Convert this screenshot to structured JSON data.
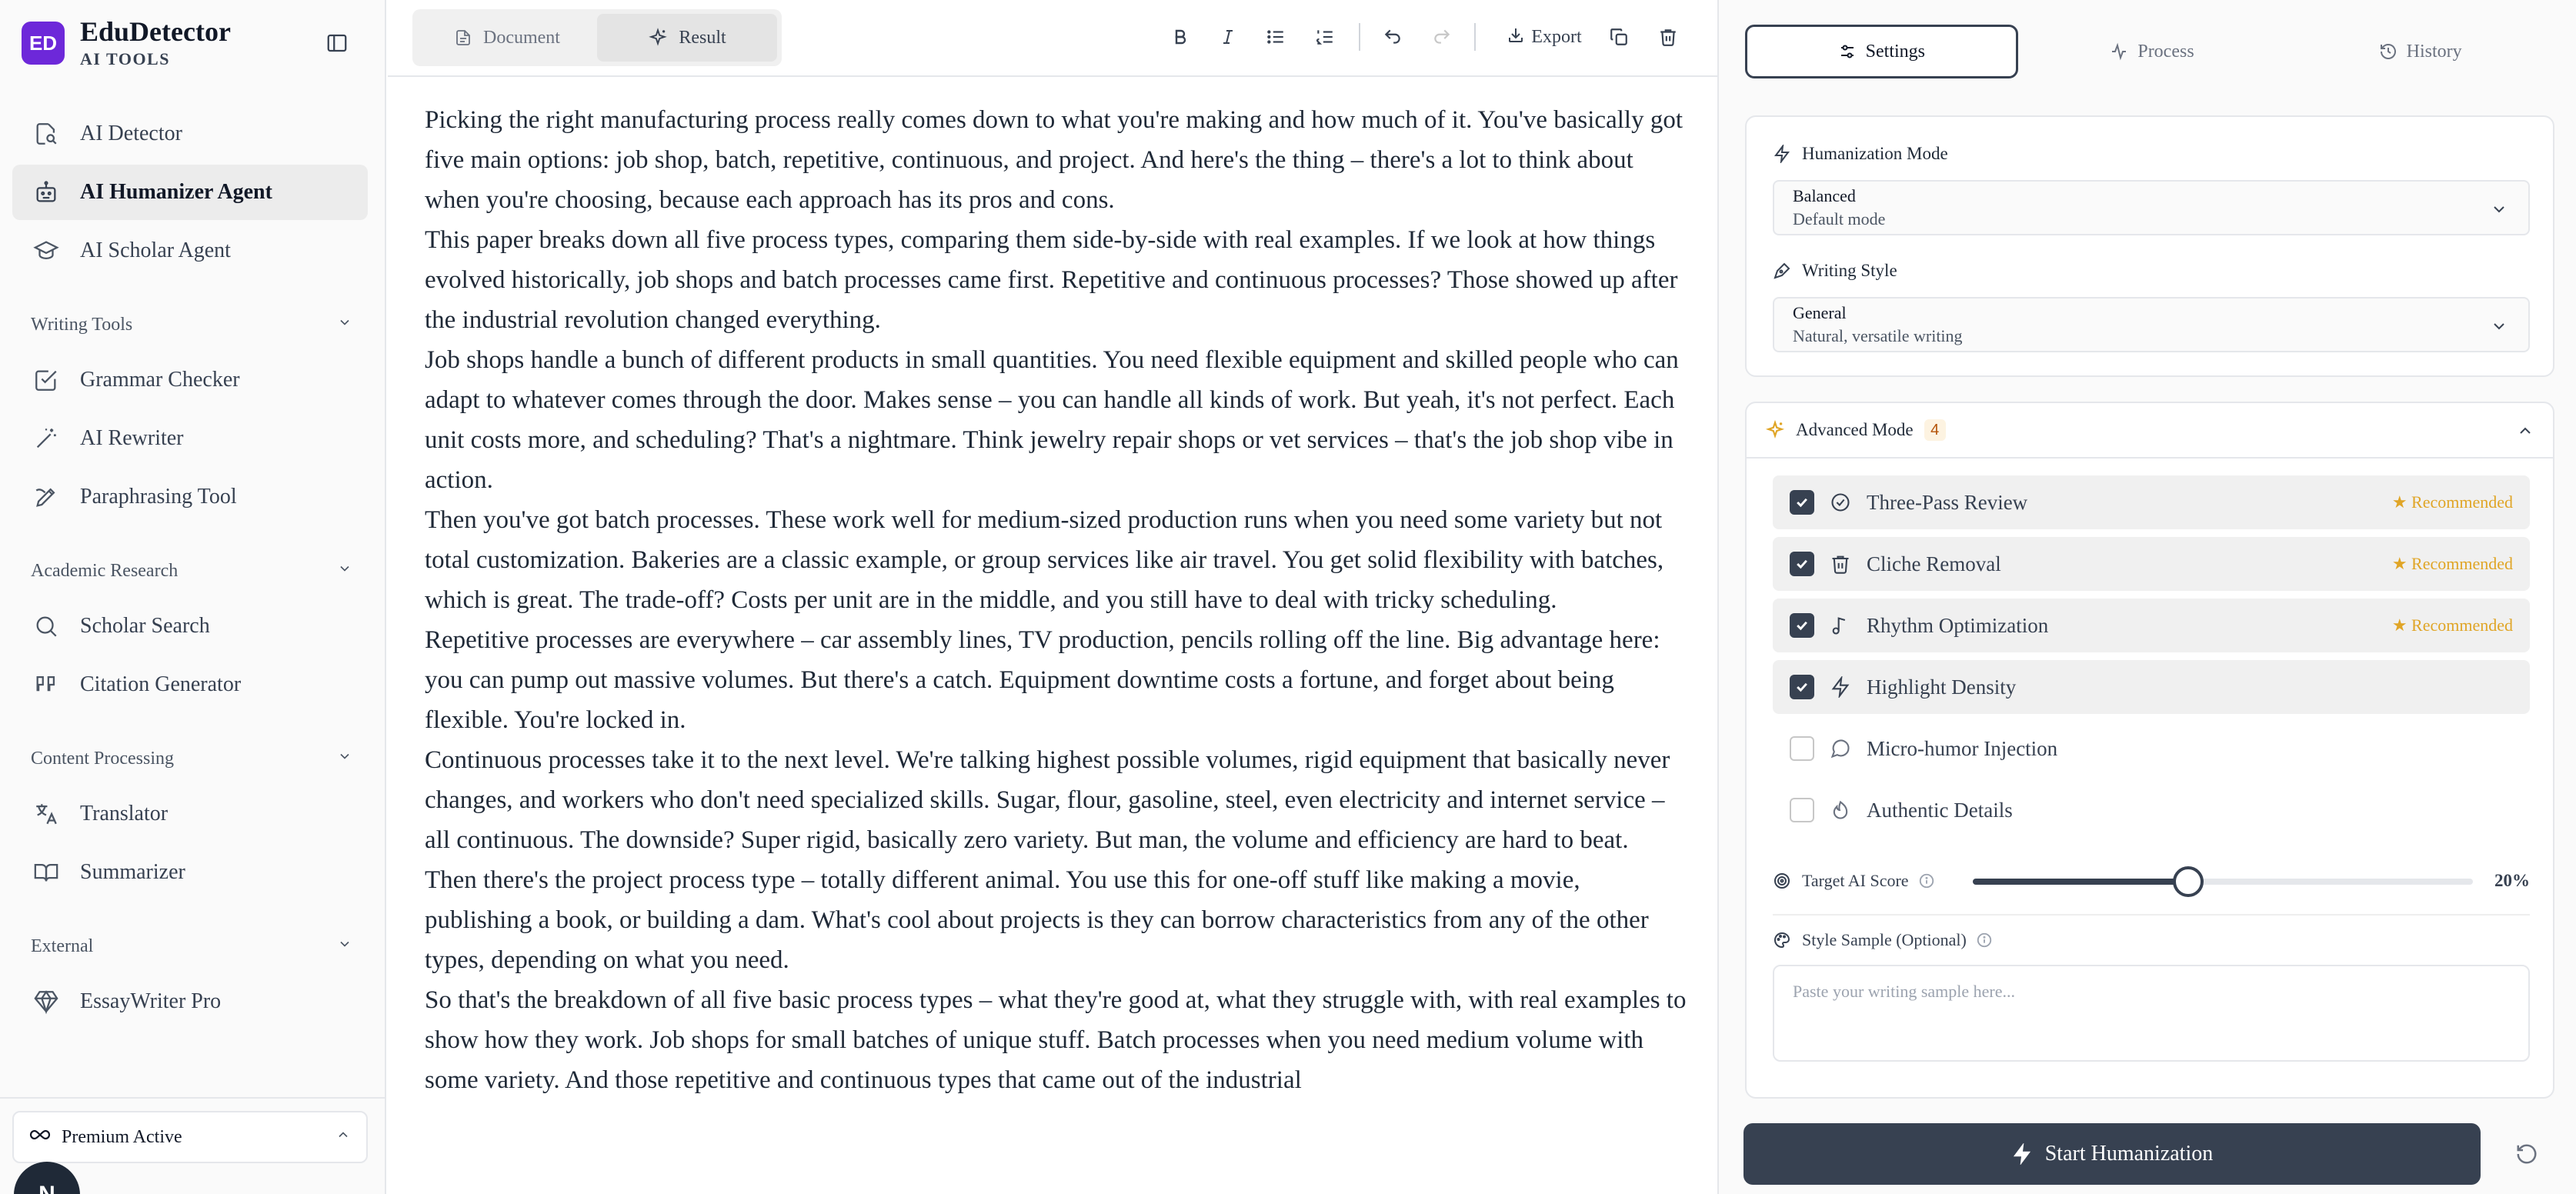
{
  "brand": {
    "logo": "ED",
    "name": "EduDetector",
    "subtitle": "AI TOOLS"
  },
  "sidebar": {
    "top_items": [
      {
        "label": "AI Detector",
        "icon": "document-search-icon"
      },
      {
        "label": "AI Humanizer Agent",
        "icon": "robot-icon",
        "active": true
      },
      {
        "label": "AI Scholar Agent",
        "icon": "graduation-cap-icon"
      }
    ],
    "sections": [
      {
        "title": "Writing Tools",
        "items": [
          {
            "label": "Grammar Checker",
            "icon": "check-square-icon"
          },
          {
            "label": "AI Rewriter",
            "icon": "magic-wand-icon"
          },
          {
            "label": "Paraphrasing Tool",
            "icon": "pen-icon"
          }
        ]
      },
      {
        "title": "Academic Research",
        "items": [
          {
            "label": "Scholar Search",
            "icon": "search-icon"
          },
          {
            "label": "Citation Generator",
            "icon": "quote-icon"
          }
        ]
      },
      {
        "title": "Content Processing",
        "items": [
          {
            "label": "Translator",
            "icon": "translate-icon"
          },
          {
            "label": "Summarizer",
            "icon": "book-icon"
          }
        ]
      },
      {
        "title": "External",
        "items": [
          {
            "label": "EssayWriter Pro",
            "icon": "gem-icon"
          }
        ]
      }
    ],
    "premium": "Premium Active",
    "avatar_initial": "N"
  },
  "editor": {
    "tabs": [
      {
        "label": "Document",
        "active": false
      },
      {
        "label": "Result",
        "active": true
      }
    ],
    "export_label": "Export",
    "paragraphs": [
      "Picking the right manufacturing process really comes down to what you're making and how much of it. You've basically got five main options: job shop, batch, repetitive, continuous, and project. And here's the thing – there's a lot to think about when you're choosing, because each approach has its pros and cons.",
      "This paper breaks down all five process types, comparing them side-by-side with real examples. If we look at how things evolved historically, job shops and batch processes came first. Repetitive and continuous processes? Those showed up after the industrial revolution changed everything.",
      "Job shops handle a bunch of different products in small quantities. You need flexible equipment and skilled people who can adapt to whatever comes through the door. Makes sense – you can handle all kinds of work. But yeah, it's not perfect. Each unit costs more, and scheduling? That's a nightmare. Think jewelry repair shops or vet services – that's the job shop vibe in action.",
      "Then you've got batch processes. These work well for medium-sized production runs when you need some variety but not total customization. Bakeries are a classic example, or group services like air travel. You get solid flexibility with batches, which is great. The trade-off? Costs per unit are in the middle, and you still have to deal with tricky scheduling.",
      "Repetitive processes are everywhere – car assembly lines, TV production, pencils rolling off the line. Big advantage here: you can pump out massive volumes. But there's a catch. Equipment downtime costs a fortune, and forget about being flexible. You're locked in.",
      "Continuous processes take it to the next level. We're talking highest possible volumes, rigid equipment that basically never changes, and workers who don't need specialized skills. Sugar, flour, gasoline, steel, even electricity and internet service – all continuous. The downside? Super rigid, basically zero variety. But man, the volume and efficiency are hard to beat.",
      "Then there's the project process type – totally different animal. You use this for one-off stuff like making a movie, publishing a book, or building a dam. What's cool about projects is they can borrow characteristics from any of the other types, depending on what you need.",
      "So that's the breakdown of all five basic process types – what they're good at, what they struggle with, with real examples to show how they work. Job shops for small batches of unique stuff. Batch processes when you need medium volume with some variety. And those repetitive and continuous types that came out of the industrial"
    ]
  },
  "panel": {
    "tabs": [
      {
        "label": "Settings",
        "active": true
      },
      {
        "label": "Process",
        "active": false
      },
      {
        "label": "History",
        "active": false
      }
    ],
    "humanization_mode": {
      "label": "Humanization Mode",
      "value": "Balanced",
      "description": "Default mode"
    },
    "writing_style": {
      "label": "Writing Style",
      "value": "General",
      "description": "Natural, versatile writing"
    },
    "advanced": {
      "label": "Advanced Mode",
      "count": "4",
      "options": [
        {
          "label": "Three-Pass Review",
          "checked": true,
          "recommended": "★ Recommended",
          "icon": "check-circle-icon"
        },
        {
          "label": "Cliche Removal",
          "checked": true,
          "recommended": "★ Recommended",
          "icon": "trash-icon"
        },
        {
          "label": "Rhythm Optimization",
          "checked": true,
          "recommended": "★ Recommended",
          "icon": "music-note-icon"
        },
        {
          "label": "Highlight Density",
          "checked": true,
          "recommended": "",
          "icon": "lightning-icon"
        },
        {
          "label": "Micro-humor Injection",
          "checked": false,
          "recommended": "",
          "icon": "chat-bubble-icon"
        },
        {
          "label": "Authentic Details",
          "checked": false,
          "recommended": "",
          "icon": "fingerprint-icon"
        }
      ]
    },
    "target_score": {
      "label": "Target AI Score",
      "value_text": "20%",
      "level": 0.43
    },
    "style_sample": {
      "label": "Style Sample (Optional)",
      "placeholder": "Paste your writing sample here..."
    },
    "start_label": "Start Humanization"
  },
  "colors": {
    "accent": "#374151",
    "brand": "#6d28d9",
    "recommended": "#e0a526"
  }
}
